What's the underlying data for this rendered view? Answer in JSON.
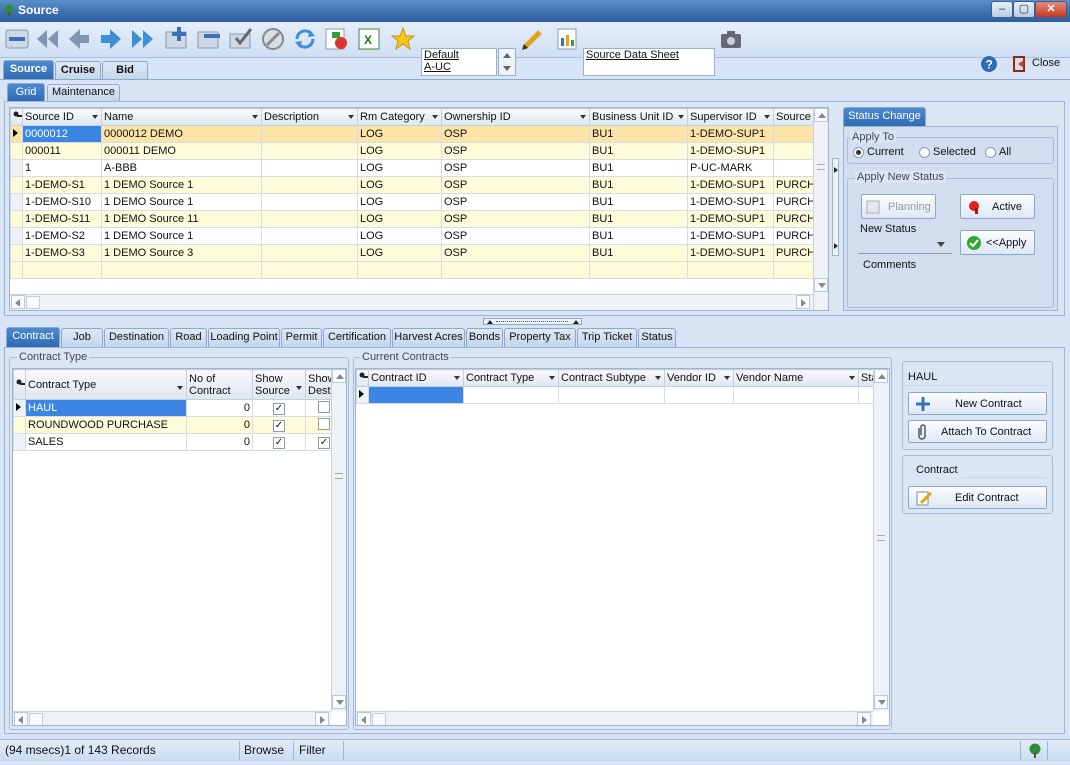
{
  "window": {
    "title": "Source"
  },
  "toolbar": {
    "combo_lines": [
      "Default",
      "A-UC"
    ],
    "report": "Source Data Sheet",
    "close_label": "Close",
    "icons": [
      "remove-icon",
      "first-record-icon",
      "prev-record-icon",
      "next-record-icon",
      "last-record-icon",
      "add-icon",
      "delete-icon",
      "post-icon",
      "cancel-icon",
      "refresh-icon",
      "filter-icon",
      "excel-icon",
      "favorite-icon",
      "edit-pencil-icon",
      "report-icon",
      "camera-icon",
      "help-icon",
      "close-door-icon"
    ]
  },
  "main_tabs": [
    "Source",
    "Cruise",
    "Bid"
  ],
  "sub_tabs": [
    "Grid",
    "Maintenance"
  ],
  "source_grid": {
    "columns": [
      "Source ID",
      "Name",
      "Description",
      "Rm Category",
      "Ownership ID",
      "Business Unit ID",
      "Supervisor ID",
      "Source T"
    ],
    "rows": [
      [
        "0000012",
        "0000012 DEMO",
        "",
        "LOG",
        "OSP",
        "BU1",
        "1-DEMO-SUP1",
        ""
      ],
      [
        "000011",
        "000011 DEMO",
        "",
        "LOG",
        "OSP",
        "BU1",
        "1-DEMO-SUP1",
        ""
      ],
      [
        "1",
        "A-BBB",
        "",
        "LOG",
        "OSP",
        "BU1",
        "P-UC-MARK",
        ""
      ],
      [
        "1-DEMO-S1",
        "1 DEMO Source 1",
        "",
        "LOG",
        "OSP",
        "BU1",
        "1-DEMO-SUP1",
        "PURCHA"
      ],
      [
        "1-DEMO-S10",
        "1 DEMO Source 1",
        "",
        "LOG",
        "OSP",
        "BU1",
        "1-DEMO-SUP1",
        "PURCHA"
      ],
      [
        "1-DEMO-S11",
        "1 DEMO Source 11",
        "",
        "LOG",
        "OSP",
        "BU1",
        "1-DEMO-SUP1",
        "PURCHA"
      ],
      [
        "1-DEMO-S2",
        "1 DEMO Source 1",
        "",
        "LOG",
        "OSP",
        "BU1",
        "1-DEMO-SUP1",
        "PURCHA"
      ],
      [
        "1-DEMO-S3",
        "1 DEMO Source 3",
        "",
        "LOG",
        "OSP",
        "BU1",
        "1-DEMO-SUP1",
        "PURCHA"
      ]
    ]
  },
  "status_change": {
    "tab": "Status Change",
    "apply_to": "Apply To",
    "options": [
      "Current",
      "Selected",
      "All"
    ],
    "apply_new_status": "Apply New Status",
    "planning": "Planning",
    "active": "Active",
    "new_status": "New Status",
    "apply": "<<Apply",
    "comments": "Comments"
  },
  "detail_tabs": [
    "Contract",
    "Job",
    "Destination",
    "Road",
    "Loading Point",
    "Permit",
    "Certification",
    "Harvest Acres",
    "Bonds",
    "Property Tax",
    "Trip Ticket",
    "Status"
  ],
  "contract_type": {
    "title": "Contract Type",
    "columns": [
      "Contract Type",
      "No of Contract",
      "Show Source",
      "Show Dest."
    ],
    "rows": [
      {
        "type": "HAUL",
        "count": "0",
        "show_source": true,
        "show_dest": false
      },
      {
        "type": "ROUNDWOOD PURCHASE",
        "count": "0",
        "show_source": true,
        "show_dest": false
      },
      {
        "type": "SALES",
        "count": "0",
        "show_source": true,
        "show_dest": true
      }
    ]
  },
  "current_contracts": {
    "title": "Current Contracts",
    "columns": [
      "Contract ID",
      "Contract Type",
      "Contract Subtype",
      "Vendor ID",
      "Vendor Name",
      "Sta"
    ]
  },
  "contract_actions": {
    "type_value": "HAUL",
    "new_contract": "New Contract",
    "attach": "Attach To Contract",
    "contract_label": "Contract",
    "edit": "Edit Contract"
  },
  "statusbar": {
    "records": "(94 msecs)1 of 143 Records",
    "mode": "Browse",
    "filter": "Filter"
  }
}
